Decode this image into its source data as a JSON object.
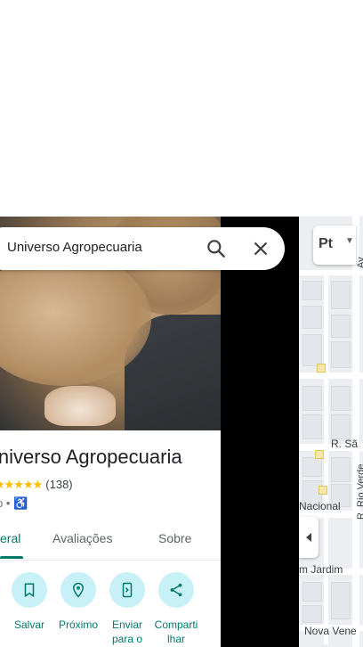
{
  "search": {
    "query": "Universo Agropecuaria"
  },
  "place": {
    "name": "Universo Agropecuaria",
    "stars": "★★★★★",
    "review_count": "(138)",
    "category_fragment": "p",
    "separator": "•",
    "accessibility_icon": "wheelchair-icon"
  },
  "tabs": [
    {
      "label": "eral",
      "active": true
    },
    {
      "label": "Avaliações",
      "active": false
    },
    {
      "label": "Sobre",
      "active": false
    }
  ],
  "actions": [
    {
      "label": "Salvar",
      "icon": "bookmark-icon"
    },
    {
      "label": "Próximo",
      "icon": "nearby-icon"
    },
    {
      "label": "Enviar para o",
      "icon": "send-to-phone-icon"
    },
    {
      "label": "Comparti lhar",
      "icon": "share-icon"
    }
  ],
  "map": {
    "layer_button_label": "Pt",
    "labels": {
      "street_r_sao": "R. Sã",
      "nacional": "Nacional",
      "jardim": "m Jardim",
      "nova_vene": "Nova Vene",
      "rio_verde": "R. Rio Verde",
      "top_vertical": "Av"
    }
  },
  "colors": {
    "accent": "#00796b",
    "action_bg": "#c8f0f7",
    "star": "#fbbc04",
    "link": "#1a73e8"
  }
}
